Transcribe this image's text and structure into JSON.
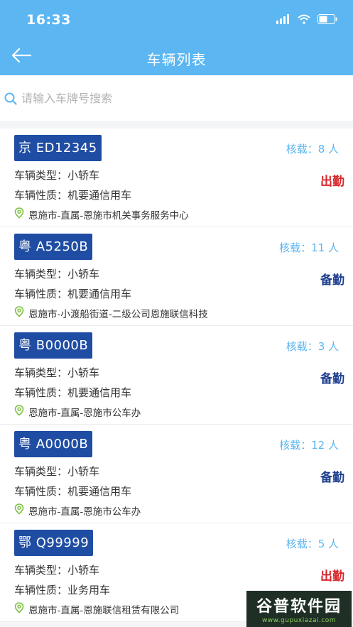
{
  "status_bar": {
    "time": "16:33"
  },
  "header": {
    "title": "车辆列表",
    "back_icon": "back-arrow-icon"
  },
  "search": {
    "placeholder": "请输入车牌号搜索",
    "value": ""
  },
  "colors": {
    "header": "#5bb6f2",
    "plate": "#1f4da3",
    "status_out": "#d9262c",
    "status_standby": "#1f3f8f",
    "location_icon": "#7dc242"
  },
  "vehicles": [
    {
      "plate": "京 ED12345",
      "capacity": "核载：8 人",
      "type": "车辆类型：小轿车",
      "nature": "车辆性质：机要通信用车",
      "location": "恩施市-直属-恩施市机关事务服务中心",
      "status": "出勤",
      "status_kind": "out"
    },
    {
      "plate": "粤 A5250B",
      "capacity": "核载：11 人",
      "type": "车辆类型：小轿车",
      "nature": "车辆性质：机要通信用车",
      "location": "恩施市-小渡船街道-二级公司恩施联信科技",
      "status": "备勤",
      "status_kind": "standby"
    },
    {
      "plate": "粤 B0000B",
      "capacity": "核载：3 人",
      "type": "车辆类型：小轿车",
      "nature": "车辆性质：机要通信用车",
      "location": "恩施市-直属-恩施市公车办",
      "status": "备勤",
      "status_kind": "standby"
    },
    {
      "plate": "粤 A0000B",
      "capacity": "核载：12 人",
      "type": "车辆类型：小轿车",
      "nature": "车辆性质：机要通信用车",
      "location": "恩施市-直属-恩施市公车办",
      "status": "备勤",
      "status_kind": "standby"
    },
    {
      "plate": "鄂 Q99999",
      "capacity": "核载：5 人",
      "type": "车辆类型：小轿车",
      "nature": "车辆性质：业务用车",
      "location": "恩施市-直属-恩施联信租赁有限公司",
      "status": "出勤",
      "status_kind": "out"
    }
  ],
  "watermark": {
    "main": "谷普软件园",
    "url": "www.gupuxiazai.com"
  }
}
